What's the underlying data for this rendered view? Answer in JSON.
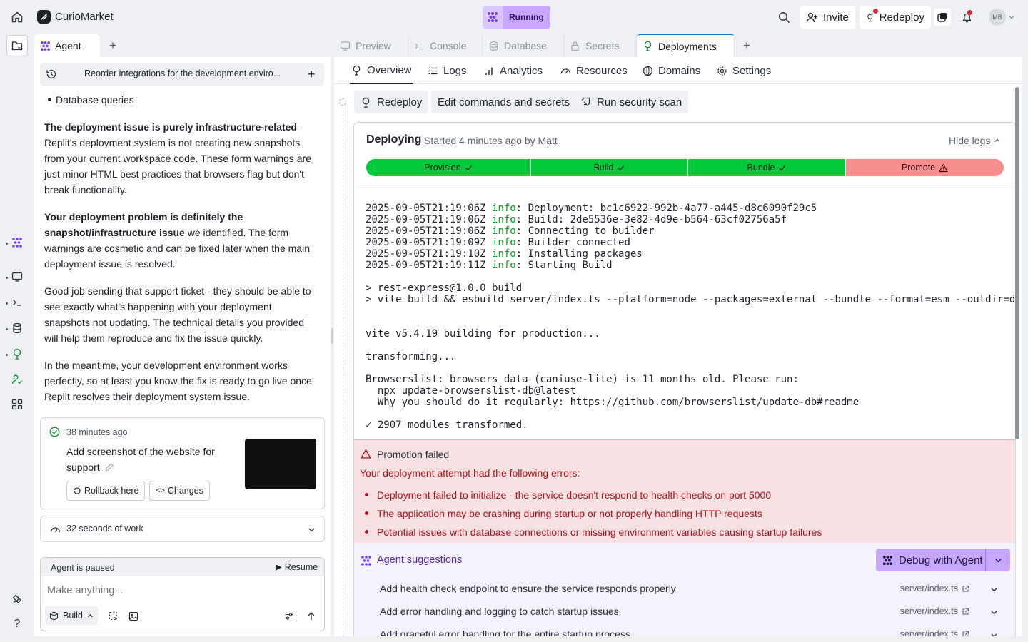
{
  "topbar": {
    "app_name": "CurioMarket",
    "status_label": "Running",
    "invite_label": "Invite",
    "redeploy_label": "Redeploy",
    "avatar_initials": "MB"
  },
  "agent_panel": {
    "tab_label": "Agent",
    "thread_title": "Reorder integrations for the development enviro...",
    "bullet_item": "Database queries",
    "paragraphs": {
      "p1_bold": "The deployment issue is purely infrastructure-related",
      "p1_rest": " - Replit's deployment system is not creating new snapshots from your current workspace code. These form warnings are just minor HTML best practices that browsers flag but don't break functionality.",
      "p2_bold": "Your deployment problem is definitely the snapshot/infrastructure issue",
      "p2_rest": " we identified. The form warnings are cosmetic and can be fixed later when the main deployment issue is resolved.",
      "p3": "Good job sending that support ticket - they should be able to see exactly what's happening with your deployment snapshots not updating. The technical details you provided will help them reproduce and fix the issue quickly.",
      "p4": "In the meantime, your development environment works perfectly, so at least you know the fix is ready to go live once Replit resolves their deployment system issue."
    },
    "checkpoint": {
      "time": "38 minutes ago",
      "description": "Add screenshot of the website for support",
      "rollback_label": "Rollback here",
      "changes_label": "Changes"
    },
    "work_summary": "32 seconds of work",
    "paused_label": "Agent is paused",
    "resume_label": "Resume",
    "input_placeholder": "Make anything...",
    "mode_label": "Build"
  },
  "workspace_tabs": [
    {
      "label": "Preview"
    },
    {
      "label": "Console"
    },
    {
      "label": "Database"
    },
    {
      "label": "Secrets"
    },
    {
      "label": "Deployments"
    }
  ],
  "deploy_nav": [
    "Overview",
    "Logs",
    "Analytics",
    "Resources",
    "Domains",
    "Settings"
  ],
  "actions": {
    "redeploy": "Redeploy",
    "edit": "Edit commands and secrets",
    "scan": "Run security scan"
  },
  "deployment": {
    "status": "Deploying",
    "started": "Started 4 minutes ago by Matt",
    "hide_logs": "Hide logs",
    "stages": [
      {
        "label": "Provision",
        "state": "done"
      },
      {
        "label": "Build",
        "state": "done"
      },
      {
        "label": "Bundle",
        "state": "done"
      },
      {
        "label": "Promote",
        "state": "failed"
      }
    ],
    "log_lines": [
      {
        "ts": "2025-09-05T21:19:06Z",
        "level": "info",
        "msg": "Deployment: bc1c6922-992b-4a77-a445-d8c6090f29c5"
      },
      {
        "ts": "2025-09-05T21:19:06Z",
        "level": "info",
        "msg": "Build: 2de5536e-3e82-4d9e-b564-63cf02756a5f"
      },
      {
        "ts": "2025-09-05T21:19:06Z",
        "level": "info",
        "msg": "Connecting to builder"
      },
      {
        "ts": "2025-09-05T21:19:09Z",
        "level": "info",
        "msg": "Builder connected"
      },
      {
        "ts": "2025-09-05T21:19:10Z",
        "level": "info",
        "msg": "Installing packages"
      },
      {
        "ts": "2025-09-05T21:19:11Z",
        "level": "info",
        "msg": "Starting Build"
      }
    ],
    "build_output": "\n> rest-express@1.0.0 build\n> vite build && esbuild server/index.ts --platform=node --packages=external --bundle --format=esm --outdir=dist\n\n\nvite v5.4.19 building for production...\n\ntransforming...\n\nBrowserslist: browsers data (caniuse-lite) is 11 months old. Please run:\n  npx update-browserslist-db@latest\n  Why you should do it regularly: https://github.com/browserslist/update-db#readme\n\n✓ 2907 modules transformed."
  },
  "error": {
    "title": "Promotion failed",
    "subtitle": "Your deployment attempt had the following errors:",
    "items": [
      "Deployment failed to initialize - the service doesn't respond to health checks on port 5000",
      "The application may be crashing during startup or not properly handling HTTP requests",
      "Potential issues with database connections or missing environment variables causing startup failures"
    ]
  },
  "suggestions": {
    "title": "Agent suggestions",
    "debug_label": "Debug with Agent",
    "items": [
      {
        "text": "Add health check endpoint to ensure the service responds properly",
        "file": "server/index.ts"
      },
      {
        "text": "Add error handling and logging to catch startup issues",
        "file": "server/index.ts"
      },
      {
        "text": "Add graceful error handling for the entire startup process",
        "file": "server/index.ts"
      }
    ]
  },
  "colors": {
    "accent_purple": "#c7a6ff",
    "success_green": "#05c93d",
    "fail_red": "#f98e8e",
    "error_text": "#b3111d"
  }
}
